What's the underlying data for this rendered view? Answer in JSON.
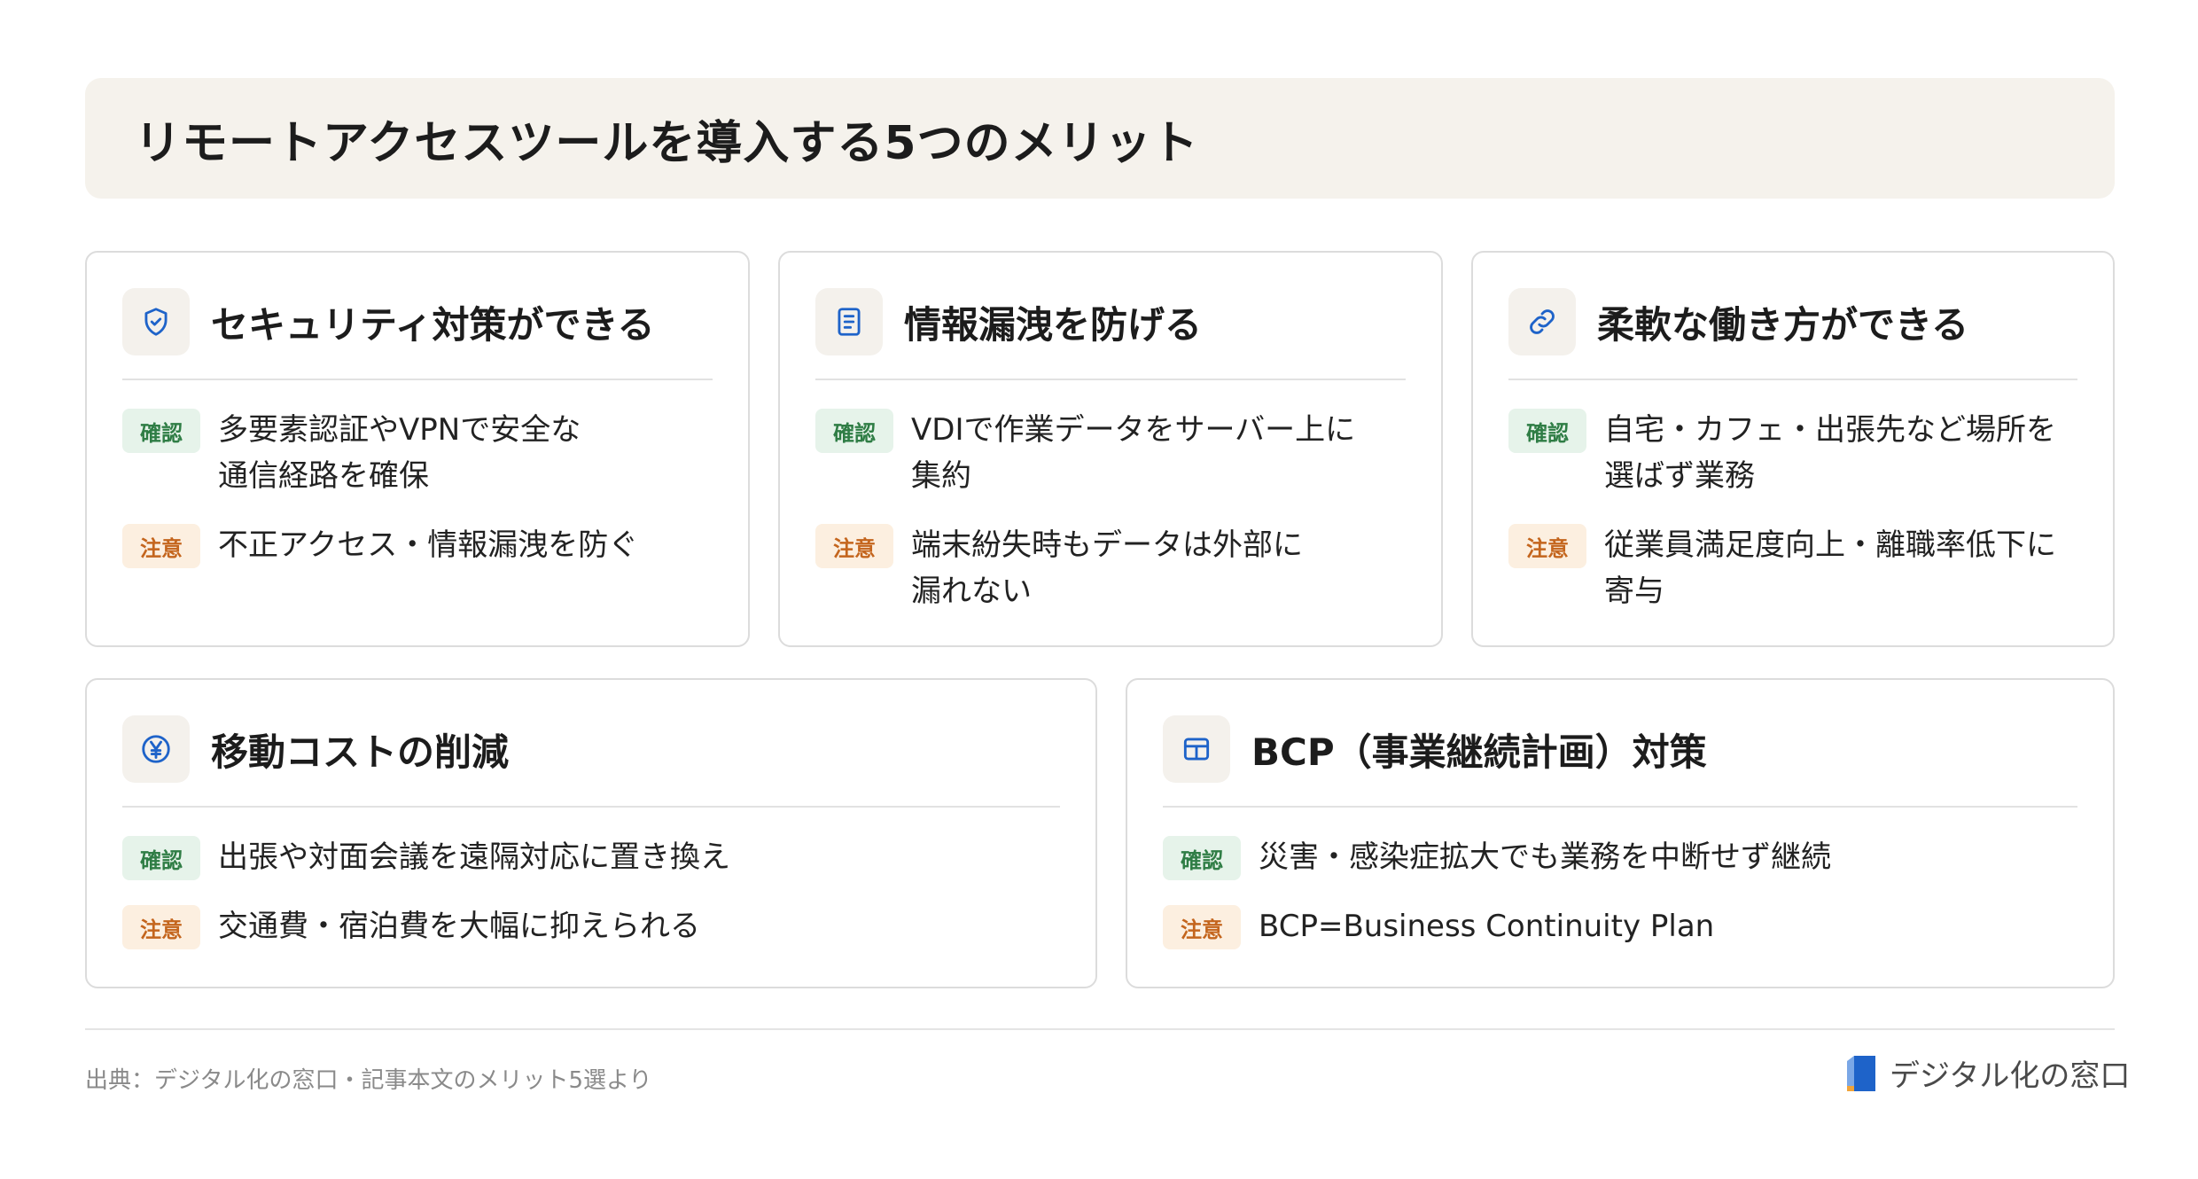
{
  "title": "リモートアクセスツールを導入する5つのメリット",
  "badges": {
    "confirm": "確認",
    "caution": "注意"
  },
  "cards": [
    {
      "title": "セキュリティ対策ができる",
      "icon": "shield-icon",
      "confirm": [
        "多要素認証やVPNで安全な",
        "通信経路を確保"
      ],
      "caution": [
        "不正アクセス・情報漏洩を防ぐ"
      ]
    },
    {
      "title": "情報漏洩を防げる",
      "icon": "document-icon",
      "confirm": [
        "VDIで作業データをサーバー上に",
        "集約"
      ],
      "caution": [
        "端末紛失時もデータは外部に",
        "漏れない"
      ]
    },
    {
      "title": "柔軟な働き方ができる",
      "icon": "link-icon",
      "confirm": [
        "自宅・カフェ・出張先など場所を",
        "選ばず業務"
      ],
      "caution": [
        "従業員満足度向上・離職率低下に",
        "寄与"
      ]
    },
    {
      "title": "移動コストの削減",
      "icon": "yen-icon",
      "confirm": [
        "出張や対面会議を遠隔対応に置き換え"
      ],
      "caution": [
        "交通費・宿泊費を大幅に抑えられる"
      ]
    },
    {
      "title": "BCP（事業継続計画）対策",
      "icon": "grid-icon",
      "confirm": [
        "災害・感染症拡大でも業務を中断せず継続"
      ],
      "caution": [
        "BCP=Business Continuity Plan"
      ]
    }
  ],
  "footer": {
    "source": "出典：デジタル化の窓口・記事本文のメリット5選より",
    "logo_text": "デジタル化の窓口"
  },
  "colors": {
    "accent": "#1e63c9",
    "confirm": "#2f7d45",
    "caution": "#c4651d",
    "title_bg": "#f5f2ec"
  }
}
